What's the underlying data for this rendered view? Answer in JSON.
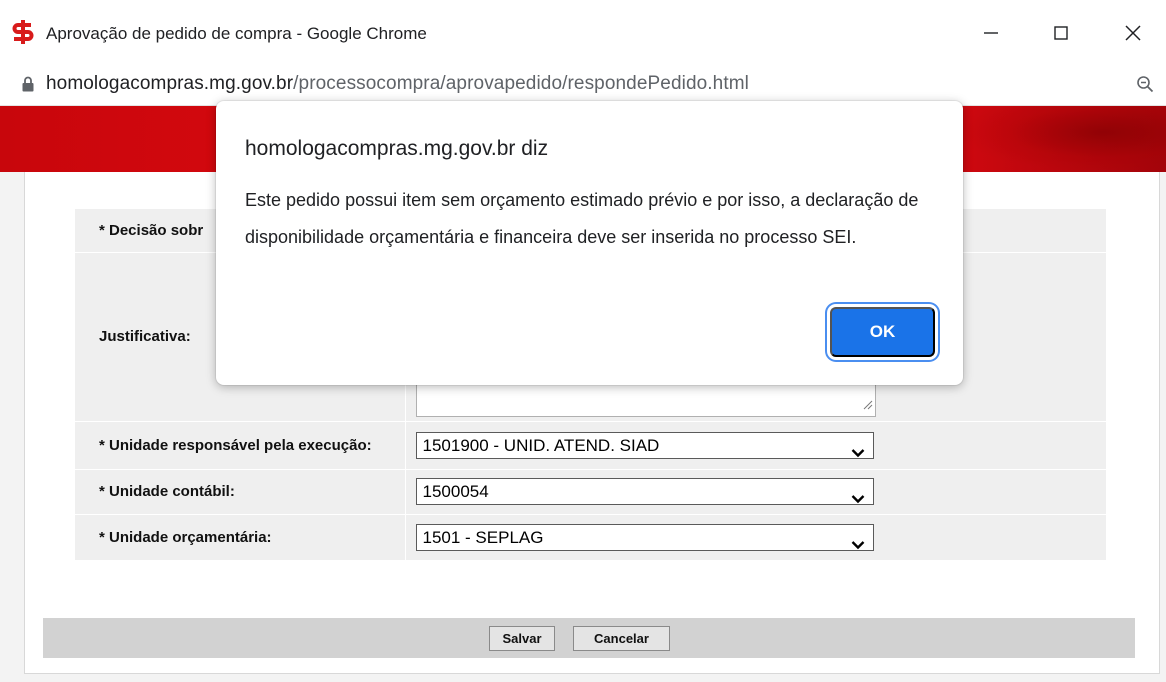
{
  "window": {
    "title": "Aprovação de pedido de compra - Google Chrome",
    "url_host": "homologacompras.mg.gov.br",
    "url_path": "/processocompra/aprovapedido/respondePedido.html"
  },
  "form": {
    "decision_label": "* Decisão sobr",
    "justification_label": "Justificativa:",
    "unidade_resp_label": "* Unidade responsável pela execução:",
    "unidade_resp_value": "1501900 - UNID. ATEND. SIAD",
    "unidade_contabil_label": "* Unidade contábil:",
    "unidade_contabil_value": "1500054",
    "unidade_orc_label": "* Unidade orçamentária:",
    "unidade_orc_value": "1501 - SEPLAG",
    "save_label": "Salvar",
    "cancel_label": "Cancelar"
  },
  "dialog": {
    "title": "homologacompras.mg.gov.br diz",
    "message": "Este pedido possui item sem orçamento estimado prévio e por isso, a declaração de disponibilidade orçamentária e financeira deve ser inserida no processo SEI.",
    "ok_label": "OK"
  },
  "colors": {
    "header_red": "#e00b10",
    "dialog_button": "#1a73e8",
    "table_bg": "#efefef"
  },
  "icons": [
    "siad-logo-icon",
    "minimize-icon",
    "maximize-icon",
    "close-icon",
    "lock-icon",
    "zoom-icon",
    "chevron-down-icon",
    "resize-grip-icon"
  ]
}
